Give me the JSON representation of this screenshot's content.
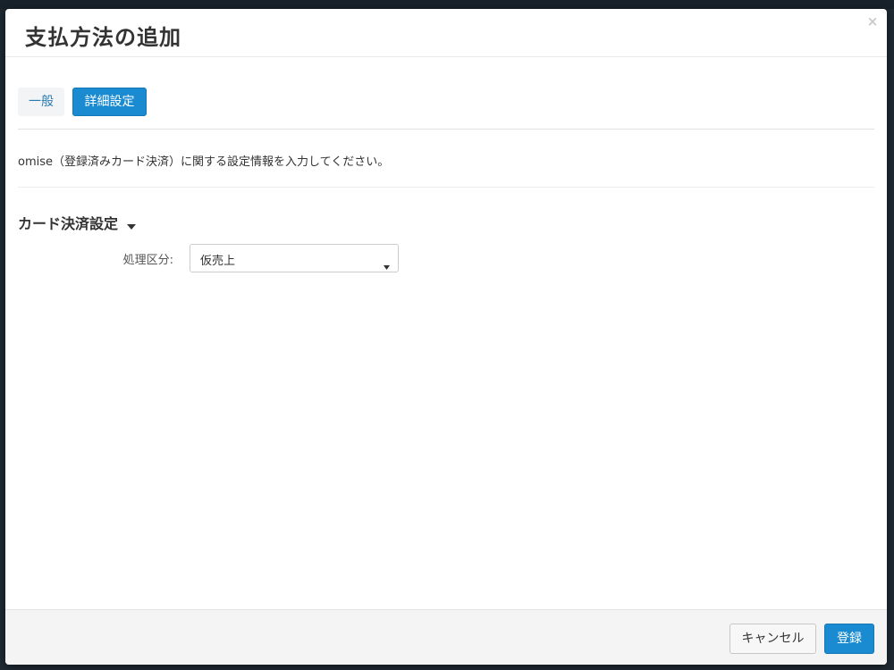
{
  "modal": {
    "title": "支払方法の追加",
    "close_glyph": "×"
  },
  "tabs": [
    {
      "label": "一般",
      "active": false
    },
    {
      "label": "詳細設定",
      "active": true
    }
  ],
  "description": "omise（登録済みカード決済）に関する設定情報を入力してください。",
  "section": {
    "heading": "カード決済設定"
  },
  "form": {
    "processing_type": {
      "label": "処理区分:",
      "selected": "仮売上"
    }
  },
  "footer": {
    "cancel_label": "キャンセル",
    "submit_label": "登録"
  },
  "colors": {
    "primary": "#1a8bd1",
    "backdrop": "#1f2a33"
  }
}
